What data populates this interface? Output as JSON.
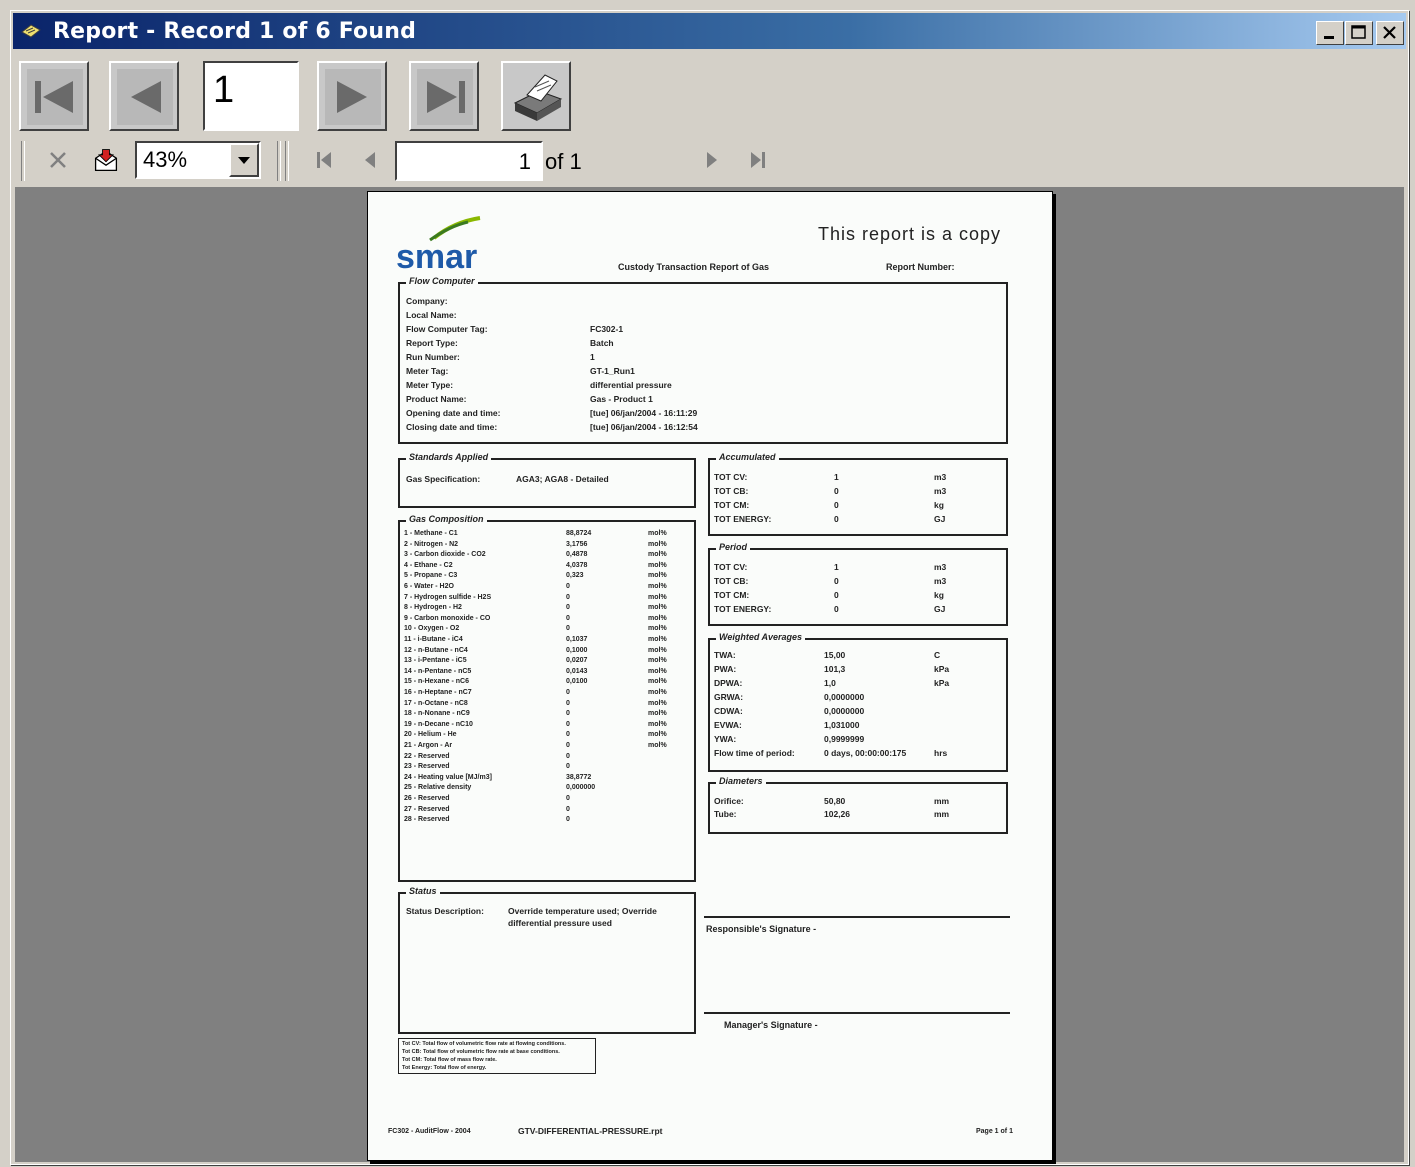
{
  "window": {
    "title": "Report - Record 1 of 6 Found",
    "buttons": [
      "minimize",
      "maximize",
      "close"
    ]
  },
  "toolbar1": {
    "record_number": "1"
  },
  "toolbar2": {
    "zoom": "43%",
    "page_input": "1",
    "page_of": "of 1"
  },
  "report": {
    "copy_notice": "This report is a copy",
    "logo_text": "smar",
    "header_title": "Custody Transaction Report of Gas",
    "report_number_label": "Report Number:",
    "flow_computer": {
      "label": "Flow Computer",
      "rows": [
        {
          "k": "Company:",
          "v": ""
        },
        {
          "k": "Local Name:",
          "v": ""
        },
        {
          "k": "Flow Computer Tag:",
          "v": "FC302-1"
        },
        {
          "k": "Report Type:",
          "v": "Batch"
        },
        {
          "k": "Run Number:",
          "v": "1"
        },
        {
          "k": "Meter Tag:",
          "v": "GT-1_Run1"
        },
        {
          "k": "Meter Type:",
          "v": "differential pressure"
        },
        {
          "k": "Product Name:",
          "v": "Gas - Product 1"
        },
        {
          "k": "Opening date and time:",
          "v": "[tue] 06/jan/2004 - 16:11:29"
        },
        {
          "k": "Closing date and time:",
          "v": "[tue] 06/jan/2004 - 16:12:54"
        }
      ]
    },
    "standards": {
      "label": "Standards Applied",
      "key": "Gas Specification:",
      "value": "AGA3; AGA8 - Detailed"
    },
    "composition": {
      "label": "Gas Composition",
      "rows": [
        {
          "k": "1 - Methane - C1",
          "v": "88,8724",
          "u": "mol%"
        },
        {
          "k": "2 - Nitrogen - N2",
          "v": "3,1756",
          "u": "mol%"
        },
        {
          "k": "3 - Carbon dioxide - CO2",
          "v": "0,4878",
          "u": "mol%"
        },
        {
          "k": "4 - Ethane - C2",
          "v": "4,0378",
          "u": "mol%"
        },
        {
          "k": "5 - Propane - C3",
          "v": "0,323",
          "u": "mol%"
        },
        {
          "k": "6 - Water - H2O",
          "v": "0",
          "u": "mol%"
        },
        {
          "k": "7 - Hydrogen sulfide - H2S",
          "v": "0",
          "u": "mol%"
        },
        {
          "k": "8 - Hydrogen - H2",
          "v": "0",
          "u": "mol%"
        },
        {
          "k": "9 - Carbon monoxide - CO",
          "v": "0",
          "u": "mol%"
        },
        {
          "k": "10 - Oxygen - O2",
          "v": "0",
          "u": "mol%"
        },
        {
          "k": "11 - i-Butane - iC4",
          "v": "0,1037",
          "u": "mol%"
        },
        {
          "k": "12 - n-Butane - nC4",
          "v": "0,1000",
          "u": "mol%"
        },
        {
          "k": "13 - i-Pentane - iC5",
          "v": "0,0207",
          "u": "mol%"
        },
        {
          "k": "14 - n-Pentane - nC5",
          "v": "0,0143",
          "u": "mol%"
        },
        {
          "k": "15 - n-Hexane - nC6",
          "v": "0,0100",
          "u": "mol%"
        },
        {
          "k": "16 - n-Heptane - nC7",
          "v": "0",
          "u": "mol%"
        },
        {
          "k": "17 - n-Octane - nC8",
          "v": "0",
          "u": "mol%"
        },
        {
          "k": "18 - n-Nonane - nC9",
          "v": "0",
          "u": "mol%"
        },
        {
          "k": "19 - n-Decane - nC10",
          "v": "0",
          "u": "mol%"
        },
        {
          "k": "20 - Helium - He",
          "v": "0",
          "u": "mol%"
        },
        {
          "k": "21 - Argon - Ar",
          "v": "0",
          "u": "mol%"
        },
        {
          "k": "22 - Reserved",
          "v": "0",
          "u": ""
        },
        {
          "k": "23 - Reserved",
          "v": "0",
          "u": ""
        },
        {
          "k": "24 - Heating value [MJ/m3]",
          "v": "38,8772",
          "u": ""
        },
        {
          "k": "25 - Relative density",
          "v": "0,000000",
          "u": ""
        },
        {
          "k": "26 - Reserved",
          "v": "0",
          "u": ""
        },
        {
          "k": "27 - Reserved",
          "v": "0",
          "u": ""
        },
        {
          "k": "28 - Reserved",
          "v": "0",
          "u": ""
        }
      ]
    },
    "accumulated": {
      "label": "Accumulated",
      "rows": [
        {
          "k": "TOT CV:",
          "v": "1",
          "u": "m3"
        },
        {
          "k": "TOT CB:",
          "v": "0",
          "u": "m3"
        },
        {
          "k": "TOT CM:",
          "v": "0",
          "u": "kg"
        },
        {
          "k": "TOT ENERGY:",
          "v": "0",
          "u": "GJ"
        }
      ]
    },
    "period": {
      "label": "Period",
      "rows": [
        {
          "k": "TOT CV:",
          "v": "1",
          "u": "m3"
        },
        {
          "k": "TOT CB:",
          "v": "0",
          "u": "m3"
        },
        {
          "k": "TOT CM:",
          "v": "0",
          "u": "kg"
        },
        {
          "k": "TOT ENERGY:",
          "v": "0",
          "u": "GJ"
        }
      ]
    },
    "weighted": {
      "label": "Weighted Averages",
      "rows": [
        {
          "k": "TWA:",
          "v": "15,00",
          "u": "C"
        },
        {
          "k": "PWA:",
          "v": "101,3",
          "u": "kPa"
        },
        {
          "k": "DPWA:",
          "v": "1,0",
          "u": "kPa"
        },
        {
          "k": "GRWA:",
          "v": "0,0000000",
          "u": ""
        },
        {
          "k": "CDWA:",
          "v": "0,0000000",
          "u": ""
        },
        {
          "k": "EVWA:",
          "v": "1,031000",
          "u": ""
        },
        {
          "k": "YWA:",
          "v": "0,9999999",
          "u": ""
        },
        {
          "k": "Flow time of period:",
          "v": "0 days, 00:00:00:175",
          "u": "hrs"
        }
      ]
    },
    "diameters": {
      "label": "Diameters",
      "rows": [
        {
          "k": "Orifice:",
          "v": "50,80",
          "u": "mm"
        },
        {
          "k": "Tube:",
          "v": "102,26",
          "u": "mm"
        }
      ]
    },
    "status": {
      "label": "Status",
      "key": "Status Description:",
      "value_line1": "Override temperature used; Override",
      "value_line2": "differential pressure used"
    },
    "responsible_signature": "Responsible's Signature -",
    "manager_signature": "Manager's Signature -",
    "legend": [
      "Tot CV: Total flow of volumetric flow rate at flowing conditions.",
      "Tot CB: Total flow of volumetric flow rate at base conditions.",
      "Tot CM: Total flow of mass flow rate.",
      "Tot Energy: Total flow of energy."
    ],
    "footer_left": "FC302 - AuditFlow - 2004",
    "footer_file": "GTV-DIFFERENTIAL-PRESSURE.rpt",
    "footer_page": "Page 1 of 1"
  }
}
